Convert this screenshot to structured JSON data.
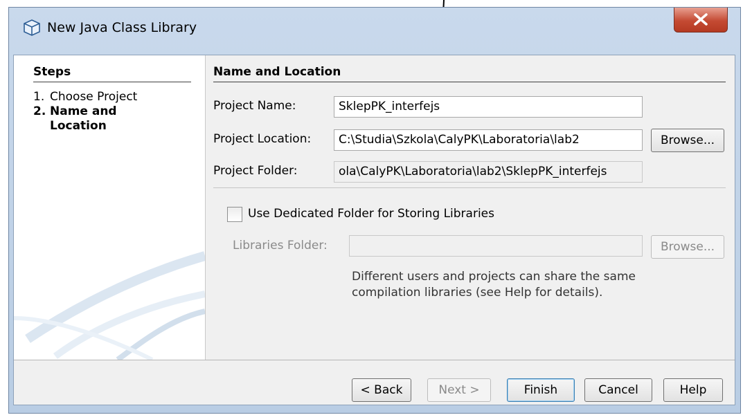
{
  "window": {
    "title": "New Java Class Library",
    "close_icon": "close-icon"
  },
  "steps": {
    "title": "Steps",
    "items": [
      {
        "num": "1.",
        "label": "Choose Project",
        "current": false
      },
      {
        "num": "2.",
        "label": "Name and Location",
        "current": true
      }
    ]
  },
  "section": {
    "title": "Name and Location"
  },
  "form": {
    "project_name_label": "Project Name:",
    "project_name_value": "SklepPK_interfejs",
    "project_location_label": "Project Location:",
    "project_location_value": "C:\\Studia\\Szkola\\CalyPK\\Laboratoria\\lab2",
    "browse_label": "Browse...",
    "project_folder_label": "Project Folder:",
    "project_folder_value": "ola\\CalyPK\\Laboratoria\\lab2\\SklepPK_interfejs",
    "dedicated_folder_label": "Use Dedicated Folder for Storing Libraries",
    "dedicated_folder_checked": false,
    "libraries_folder_label": "Libraries Folder:",
    "libraries_folder_value": "",
    "libraries_browse_label": "Browse...",
    "info_text": "Different users and projects can share the same compilation libraries (see Help for details)."
  },
  "buttons": {
    "back": "< Back",
    "next": "Next >",
    "finish": "Finish",
    "cancel": "Cancel",
    "help": "Help"
  },
  "colors": {
    "title_bar": "#c9d9ec",
    "close_button": "#c44a33",
    "panel_bg": "#f0f0f0",
    "default_button_border": "#3c7fb1"
  }
}
